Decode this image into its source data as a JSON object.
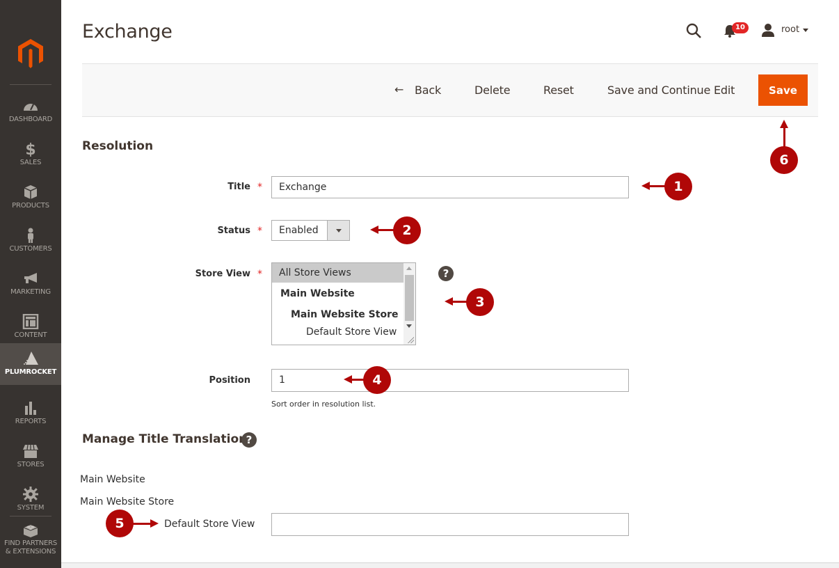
{
  "sidebar": {
    "items": [
      {
        "label": "DASHBOARD",
        "icon": "dashboard-icon"
      },
      {
        "label": "SALES",
        "icon": "dollar-icon"
      },
      {
        "label": "PRODUCTS",
        "icon": "box-icon"
      },
      {
        "label": "CUSTOMERS",
        "icon": "person-icon"
      },
      {
        "label": "MARKETING",
        "icon": "megaphone-icon"
      },
      {
        "label": "CONTENT",
        "icon": "layout-icon"
      },
      {
        "label": "PLUMROCKET",
        "icon": "plumrocket-icon",
        "active": true
      },
      {
        "label": "REPORTS",
        "icon": "bar-chart-icon"
      },
      {
        "label": "STORES",
        "icon": "storefront-icon"
      },
      {
        "label": "SYSTEM",
        "icon": "gear-icon"
      },
      {
        "label_line1": "FIND PARTNERS",
        "label_line2": "& EXTENSIONS",
        "icon": "lego-brick-icon"
      }
    ]
  },
  "header": {
    "title": "Exchange",
    "notification_count": "10",
    "username": "root"
  },
  "actions": {
    "back": "Back",
    "delete": "Delete",
    "reset": "Reset",
    "save_continue": "Save and Continue Edit",
    "save": "Save"
  },
  "colors": {
    "accent": "#eb5202",
    "sidebar_bg": "#373330",
    "callout": "#b00707"
  },
  "form": {
    "section_title": "Resolution",
    "title": {
      "label": "Title",
      "value": "Exchange",
      "required": "*"
    },
    "status": {
      "label": "Status",
      "value": "Enabled",
      "required": "*"
    },
    "store_view": {
      "label": "Store View",
      "required": "*",
      "help": "?",
      "options": [
        {
          "label": "All Store Views",
          "selected": true
        },
        {
          "label": "Main Website",
          "bold": true
        },
        {
          "label": "Main Website Store",
          "bold": true
        },
        {
          "label": "Default Store View"
        }
      ]
    },
    "position": {
      "label": "Position",
      "value": "1",
      "note": "Sort order in resolution list."
    }
  },
  "translations": {
    "section_title": "Manage Title Translations",
    "help": "?",
    "website": "Main Website",
    "store": "Main Website Store",
    "store_view_label": "Default Store View",
    "store_view_value": ""
  },
  "callouts": [
    "1",
    "2",
    "3",
    "4",
    "5",
    "6"
  ]
}
